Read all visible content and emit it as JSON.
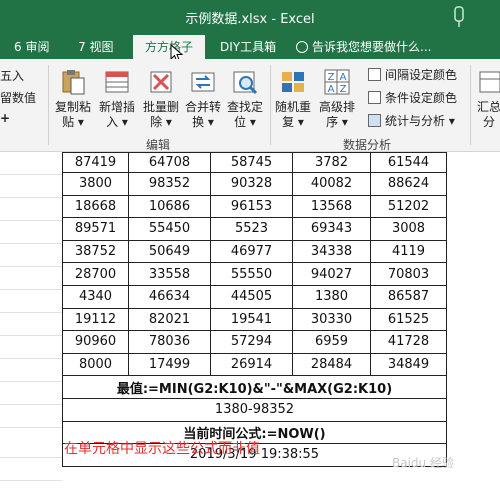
{
  "window": {
    "title": "示例数据.xlsx - Excel"
  },
  "tabs": [
    {
      "label": "6 审阅"
    },
    {
      "label": "7 视图"
    },
    {
      "label": "方方格子"
    },
    {
      "label": "DIY工具箱"
    }
  ],
  "tell_me": "告诉我您想要做什么...",
  "ribbon": {
    "left_partial": {
      "line1": "五入",
      "line2": "留数值",
      "line3": "+"
    },
    "buttons": [
      {
        "line1": "复制粘",
        "line2": "贴 ▾"
      },
      {
        "line1": "新增插",
        "line2": "入 ▾"
      },
      {
        "line1": "批量删",
        "line2": "除 ▾"
      },
      {
        "line1": "合并转",
        "line2": "换 ▾"
      },
      {
        "line1": "查找定",
        "line2": "位 ▾"
      },
      {
        "line1": "随机重",
        "line2": "复 ▾"
      },
      {
        "line1": "高级排",
        "line2": "序 ▾"
      }
    ],
    "small_buttons": [
      "间隔设定颜色",
      "条件设定颜色",
      "统计与分析 ▾"
    ],
    "right_partial": {
      "line1": "汇总",
      "line2": "分"
    },
    "group_labels": {
      "edit": "编辑",
      "analysis": "数据分析"
    },
    "sort_icon_text": {
      "a": "Z",
      "b": "A",
      "c": "A",
      "d": "Z"
    }
  },
  "table": {
    "rows": [
      [
        "87419",
        "64708",
        "58745",
        "3782",
        "61544"
      ],
      [
        "3800",
        "98352",
        "90328",
        "40082",
        "88624"
      ],
      [
        "18668",
        "10686",
        "96153",
        "13568",
        "51202"
      ],
      [
        "89571",
        "55450",
        "5523",
        "69343",
        "3008"
      ],
      [
        "38752",
        "50649",
        "46977",
        "34338",
        "4119"
      ],
      [
        "28700",
        "33558",
        "55550",
        "94027",
        "70803"
      ],
      [
        "4340",
        "46634",
        "44505",
        "1380",
        "86587"
      ],
      [
        "19112",
        "82021",
        "19541",
        "30330",
        "61525"
      ],
      [
        "90960",
        "78036",
        "57294",
        "6959",
        "41728"
      ],
      [
        "8000",
        "17499",
        "26914",
        "28484",
        "34849"
      ]
    ],
    "formula1": "最值:=MIN(G2:K10)&\"-\"&MAX(G2:K10)",
    "result1": "1380-98352",
    "formula2": "当前时间公式:=NOW()",
    "result2": "2019/3/19 19:38:55"
  },
  "note": "在单元格中显示这些公式而非值",
  "watermark": "Baidu 经验"
}
